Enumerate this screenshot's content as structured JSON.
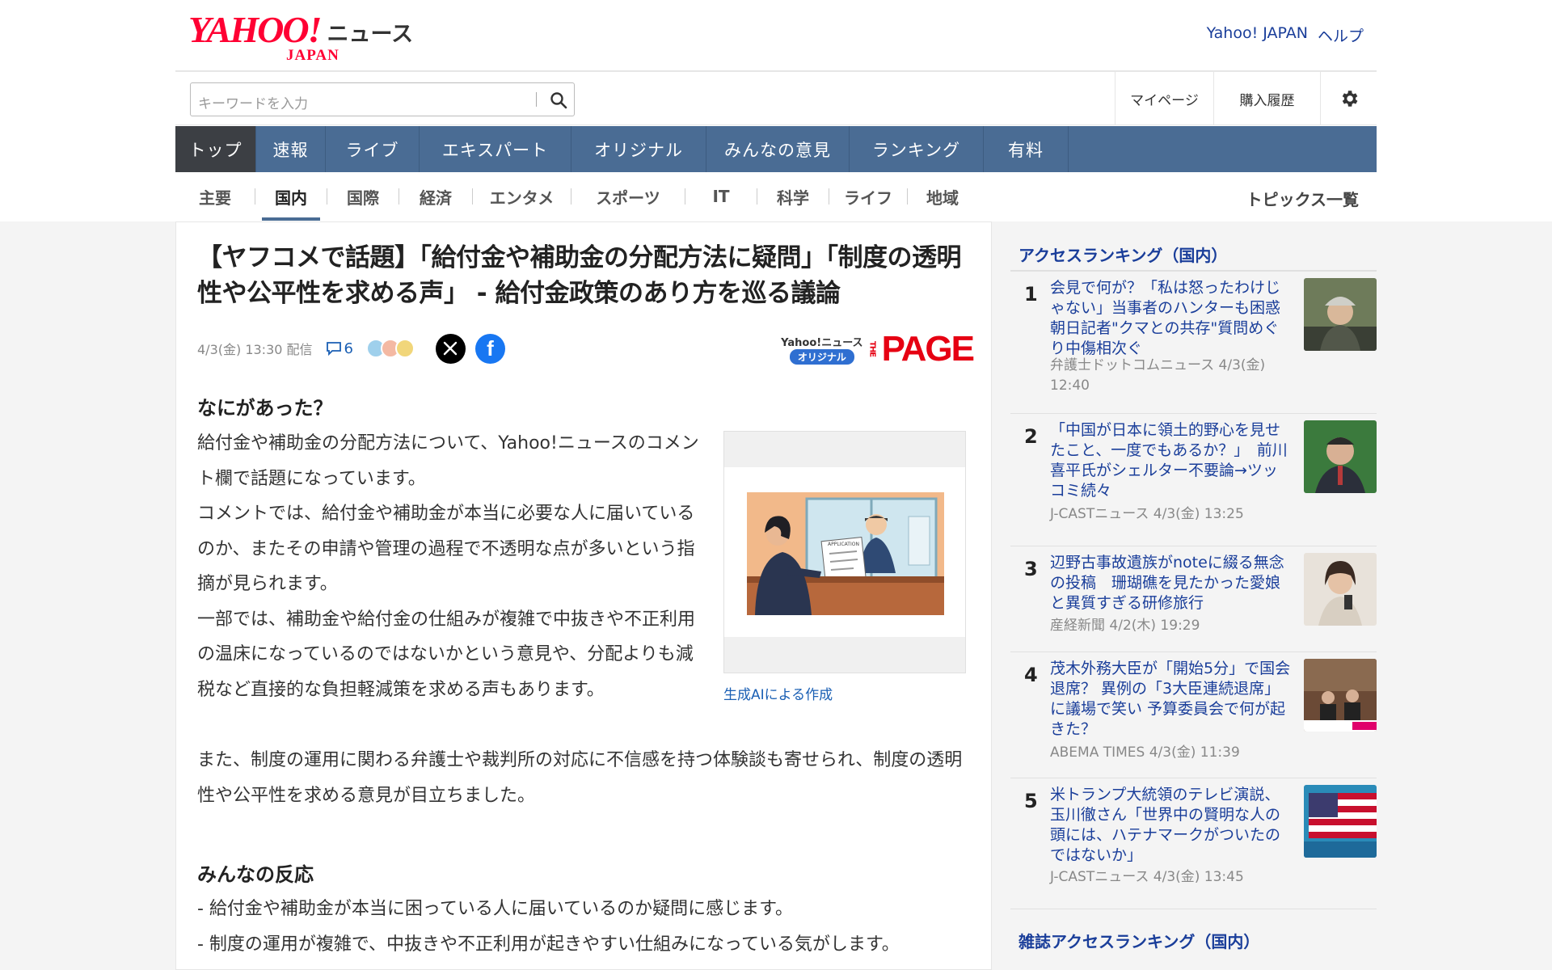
{
  "brand": {
    "logo_main": "YAHOO!",
    "logo_sub": "JAPAN",
    "service": "ニュース"
  },
  "top_links": [
    "Yahoo! JAPAN",
    "ヘルプ"
  ],
  "search": {
    "placeholder": "キーワードを入力"
  },
  "header_buttons": {
    "mypage": "マイページ",
    "purchase": "購入履歴"
  },
  "main_nav": [
    "トップ",
    "速報",
    "ライブ",
    "エキスパート",
    "オリジナル",
    "みんなの意見",
    "ランキング",
    "有料"
  ],
  "sub_nav": [
    "主要",
    "国内",
    "国際",
    "経済",
    "エンタメ",
    "スポーツ",
    "IT",
    "科学",
    "ライフ",
    "地域"
  ],
  "sub_nav_active": "国内",
  "topics_link": "トピックス一覧",
  "article": {
    "headline": "【ヤフコメで話題】「給付金や補助金の分配方法に疑問」「制度の透明性や公平性を求める声」 - 給付金政策のあり方を巡る議論",
    "date": "4/3(金) 13:30 配信",
    "comment_count": "6",
    "partner_top": "Yahoo!ニュース",
    "partner_badge": "オリジナル",
    "partner_the": "THE",
    "partner_name": "PAGE",
    "section1_title": "なにがあった？",
    "p1": "給付金や補助金の分配方法について、Yahoo!ニュースのコメント欄で話題になっています。",
    "p2": "コメントでは、給付金や補助金が本当に必要な人に届いているのか、またその申請や管理の過程で不透明な点が多いという指摘が見られます。",
    "p3": "一部では、補助金や給付金の仕組みが複雑で中抜きや不正利用の温床になっているのではないかという意見や、分配よりも減税など直接的な負担軽減策を求める声もあります。",
    "p4": "また、制度の運用に関わる弁護士や裁判所の対応に不信感を持つ体験談も寄せられ、制度の透明性や公平性を求める意見が目立ちました。",
    "image_caption": "生成AIによる作成",
    "image_doc_label": "APPLICATION",
    "section2_title": "みんなの反応",
    "reactions": [
      "- 給付金や補助金が本当に困っている人に届いているのか疑問に感じます。",
      "- 制度の運用が複雑で、中抜きや不正利用が起きやすい仕組みになっている気がします。"
    ]
  },
  "sidebar": {
    "ranking_title": "アクセスランキング（国内）",
    "ranking": [
      {
        "rank": "1",
        "title": "会見で何が？「私は怒ったわけじゃない」当事者のハンターも困惑 朝日記者\"クマとの共存\"質問めぐり中傷相次ぐ",
        "source": "弁護士ドットコムニュース 4/3(金) 12:40"
      },
      {
        "rank": "2",
        "title": "「中国が日本に領土的野心を見せたこと、一度でもあるか？」　前川喜平氏がシェルター不要論→ツッコミ続々",
        "source": "J-CASTニュース 4/3(金) 13:25"
      },
      {
        "rank": "3",
        "title": "辺野古事故遺族がnoteに綴る無念の投稿　珊瑚礁を見たかった愛娘と異質すぎる研修旅行",
        "source": "産経新聞 4/2(木) 19:29"
      },
      {
        "rank": "4",
        "title": "茂木外務大臣が「開始5分」で国会退席？ 異例の「3大臣連続退席」に議場で笑い 予算委員会で何が起きた？",
        "source": "ABEMA TIMES 4/3(金) 11:39"
      },
      {
        "rank": "5",
        "title": "米トランプ大統領のテレビ演説、玉川徹さん「世界中の賢明な人の頭には、ハテナマークがついたのではないか」",
        "source": "J-CASTニュース 4/3(金) 13:45"
      }
    ],
    "magazine_title": "雑誌アクセスランキング（国内）"
  },
  "colors": {
    "nav_bg": "#4a6c94",
    "nav_active": "#3c3f44",
    "link": "#1a3e9a",
    "brand_red": "#ff0033"
  }
}
